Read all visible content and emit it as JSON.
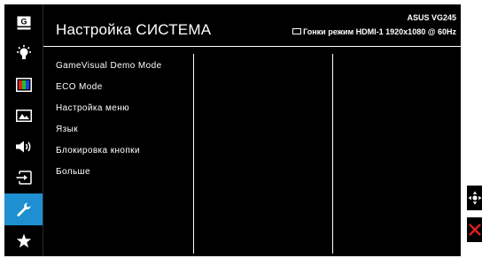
{
  "header": {
    "title": "Настройка СИСТЕМА",
    "model": "ASUS VG245",
    "status_text": "Гонки режим HDMI-1 1920x1080 @ 60Hz"
  },
  "sidebar": {
    "items": [
      {
        "name": "gaming-icon",
        "label": "G"
      },
      {
        "name": "image-brightness-icon"
      },
      {
        "name": "color-icon"
      },
      {
        "name": "image-icon"
      },
      {
        "name": "sound-icon"
      },
      {
        "name": "input-select-icon"
      },
      {
        "name": "system-setup-wrench-icon",
        "active": true
      },
      {
        "name": "favorite-star-icon"
      }
    ]
  },
  "menu": {
    "items": [
      "GameVisual Demo Mode",
      "ECO Mode",
      "Настройка меню",
      "Язык",
      "Блокировка кнопки",
      "Больше"
    ]
  },
  "controls": {
    "navigate_icon": "five-way-navigation-icon",
    "close_icon": "close-icon",
    "close_color": "#e02020"
  },
  "colors": {
    "background": "#000000",
    "accent": "#1e8fd0",
    "text": "#ffffff"
  }
}
